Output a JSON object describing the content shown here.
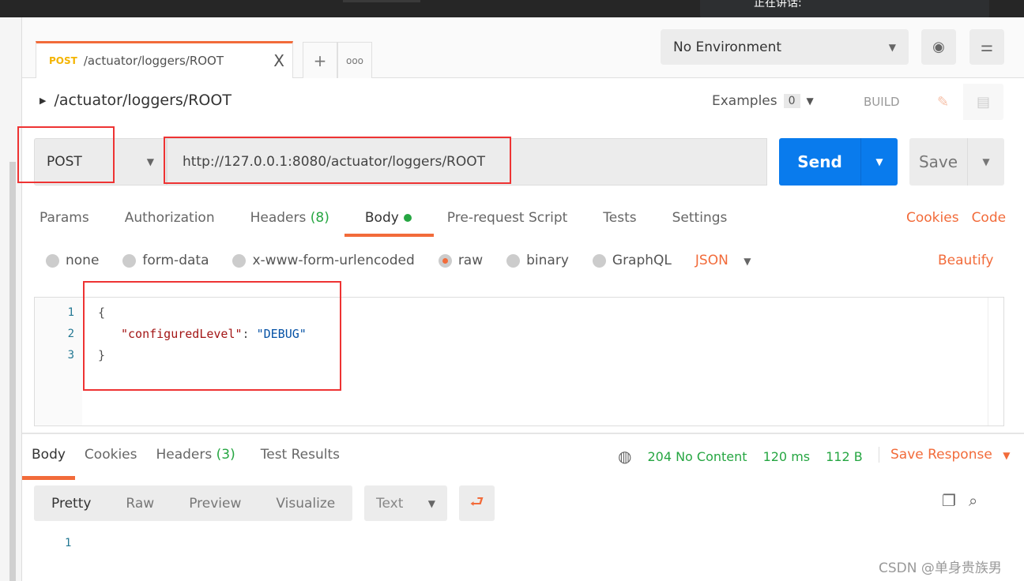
{
  "overlay": {
    "text": "正在讲话:"
  },
  "tab": {
    "method": "POST",
    "title": "/actuator/loggers/ROOT",
    "close": "X"
  },
  "tabbar": {
    "new_tab": "+",
    "more": "ooo"
  },
  "environment": {
    "selected": "No Environment"
  },
  "request": {
    "name": "/actuator/loggers/ROOT",
    "examples_label": "Examples",
    "examples_count": "0",
    "build_label": "BUILD",
    "method": "POST",
    "url": "http://127.0.0.1:8080/actuator/loggers/ROOT",
    "send_label": "Send",
    "save_label": "Save"
  },
  "req_tabs": [
    {
      "label": "Params"
    },
    {
      "label": "Authorization"
    },
    {
      "label": "Headers",
      "count": "(8)"
    },
    {
      "label": "Body"
    },
    {
      "label": "Pre-request Script"
    },
    {
      "label": "Tests"
    },
    {
      "label": "Settings"
    }
  ],
  "links": {
    "cookies": "Cookies",
    "code": "Code",
    "beautify": "Beautify"
  },
  "body_types": [
    "none",
    "form-data",
    "x-www-form-urlencoded",
    "raw",
    "binary",
    "GraphQL"
  ],
  "body_format": "JSON",
  "editor": {
    "lines": [
      "1",
      "2",
      "3"
    ],
    "open": "{",
    "key": "\"configuredLevel\"",
    "colon": ": ",
    "value": "\"DEBUG\"",
    "close": "}"
  },
  "response": {
    "tabs": [
      {
        "label": "Body"
      },
      {
        "label": "Cookies"
      },
      {
        "label": "Headers",
        "count": "(3)"
      },
      {
        "label": "Test Results"
      }
    ],
    "status": "204 No Content",
    "time": "120 ms",
    "size": "112 B",
    "save_label": "Save Response",
    "views": [
      "Pretty",
      "Raw",
      "Preview",
      "Visualize"
    ],
    "format": "Text",
    "line": "1"
  },
  "watermark": "CSDN @单身贵族男",
  "colors": {
    "accent": "#f26b3a",
    "send": "#097bed",
    "success": "#26a642",
    "method_tag": "#f4b400",
    "highlight": "#e33333"
  }
}
